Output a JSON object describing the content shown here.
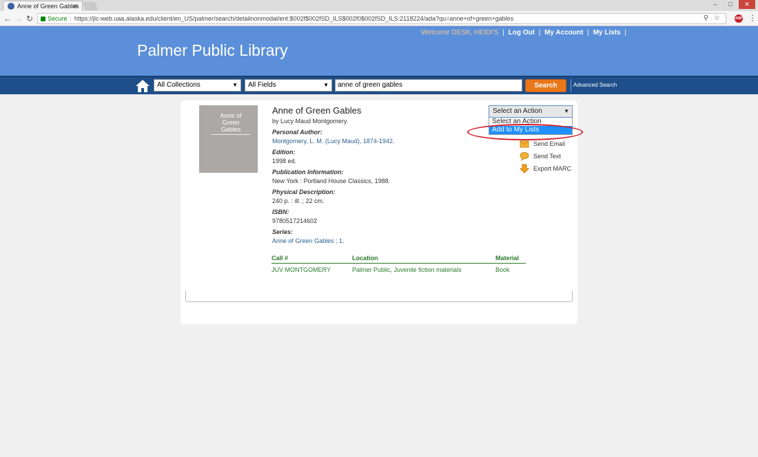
{
  "browser": {
    "tab_title": "Anne of Green Gables",
    "tab_close": "✕",
    "secure_label": "Secure",
    "url": "https://jlc-web.uaa.alaska.edu/client/en_US/palmer/search/detailnonmodal/ent:$002f$002fSD_ILS$002f0$002fSD_ILS:2118224/ada?qu=anne+of+green+gables",
    "adblock_label": "ABP"
  },
  "header": {
    "library_name": "Palmer Public Library",
    "welcome": "Welcome DESK, HEIDI'S",
    "logout": "Log Out",
    "my_account": "My Account",
    "my_lists": "My Lists",
    "separator": "|"
  },
  "search": {
    "collection": "All Collections",
    "field": "All Fields",
    "query": "anne of green gables",
    "button": "Search",
    "advanced": "Advanced Search"
  },
  "record": {
    "cover_text": "Anne of Green Gables",
    "title": "Anne of Green Gables",
    "byline": "by Lucy Maud Montgomery.",
    "fields": [
      {
        "label": "Personal Author:",
        "value": "Montgomery, L. M. (Lucy Maud), 1874-1942."
      },
      {
        "label": "Edition:",
        "value": "1998 ed."
      },
      {
        "label": "Publication Information:",
        "value": "New York : Portland House Classics, 1988."
      },
      {
        "label": "Physical Description:",
        "value": "240 p. : ill. ; 22 cm."
      },
      {
        "label": "ISBN:",
        "value": "9780517214602"
      },
      {
        "label": "Series:",
        "value": "Anne of Green Gables ; 1."
      }
    ]
  },
  "holdings": {
    "headers": [
      "Call #",
      "Location",
      "Material"
    ],
    "rows": [
      [
        "JUV MONTGOMERY",
        "Palmer Public, Juvenile fiction materials",
        "Book"
      ]
    ]
  },
  "actions": {
    "select_label": "Select an Action",
    "options": [
      "Select an Action",
      "Add to My Lists"
    ],
    "selected_index": 1,
    "items": [
      "Send Email",
      "Send Text",
      "Export MARC"
    ]
  },
  "colors": {
    "header_blue": "#5b8fd9",
    "search_bar": "#1f4f8a",
    "search_button": "#e8781a",
    "holdings_green": "#2a7a2a",
    "highlight_red": "#d21c2a"
  }
}
